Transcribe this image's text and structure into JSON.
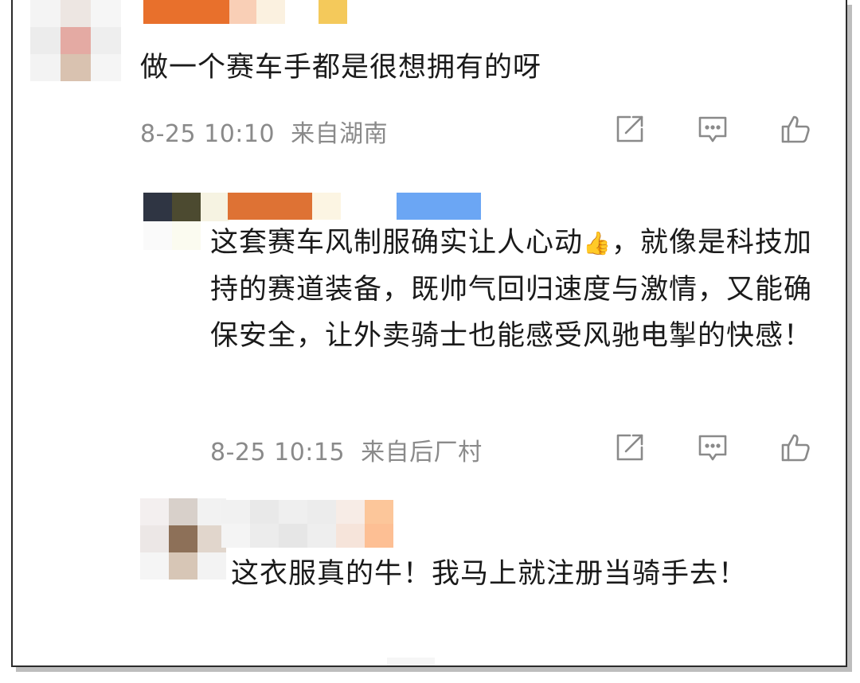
{
  "comments": [
    {
      "text": "做一个赛车手都是很想拥有的呀",
      "time": "8-25 10:10",
      "location": "来自湖南"
    },
    {
      "text_before_emoji": "这套赛车风制服确实让人心动",
      "emoji": "👍",
      "text_after_emoji": "，就像是科技加持的赛道装备，既帅气回归速度与激情，又能确保安全，让外卖骑士也能感受风驰电掣的快感！",
      "time": "8-25 10:15",
      "location": "来自后厂村"
    },
    {
      "text": "这衣服真的牛！我马上就注册当骑手去！"
    }
  ],
  "icons": {
    "share": "share-icon",
    "reply": "comment-icon",
    "like": "thumbs-up-icon"
  },
  "colors": {
    "text": "#1a1a1a",
    "meta": "#8a8a8a",
    "icon": "#8a8a8a"
  }
}
